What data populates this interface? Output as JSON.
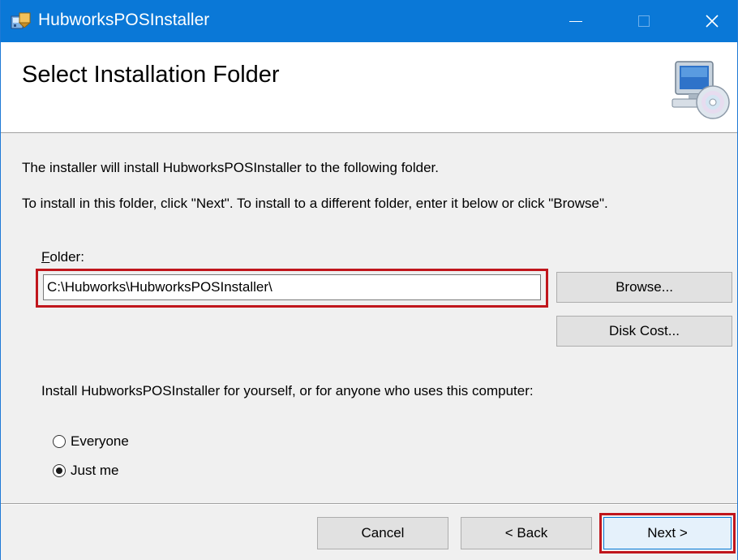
{
  "window": {
    "title": "HubworksPOSInstaller",
    "controls": {
      "minimize": "",
      "maximize": "",
      "close": "✕"
    }
  },
  "header": {
    "title": "Select Installation Folder",
    "icon": "computer-cd-icon"
  },
  "body": {
    "intro_line_1": "The installer will install HubworksPOSInstaller to the following folder.",
    "intro_line_2": "To install in this folder, click \"Next\". To install to a different folder, enter it below or click \"Browse\".",
    "folder_label_accel": "F",
    "folder_label_rest": "older:",
    "folder_value": "C:\\Hubworks\\HubworksPOSInstaller\\",
    "browse_label": "Browse...",
    "disk_cost_label": "Disk Cost...",
    "install_for_text": "Install HubworksPOSInstaller for yourself, or for anyone who uses this computer:",
    "radio_everyone": "Everyone",
    "radio_just_me": "Just me",
    "selected_option": "Just me"
  },
  "footer": {
    "cancel_label": "Cancel",
    "back_label": "< Back",
    "next_label": "Next >"
  },
  "colors": {
    "titlebar": "#0a78d7",
    "highlight": "#c0161c"
  }
}
